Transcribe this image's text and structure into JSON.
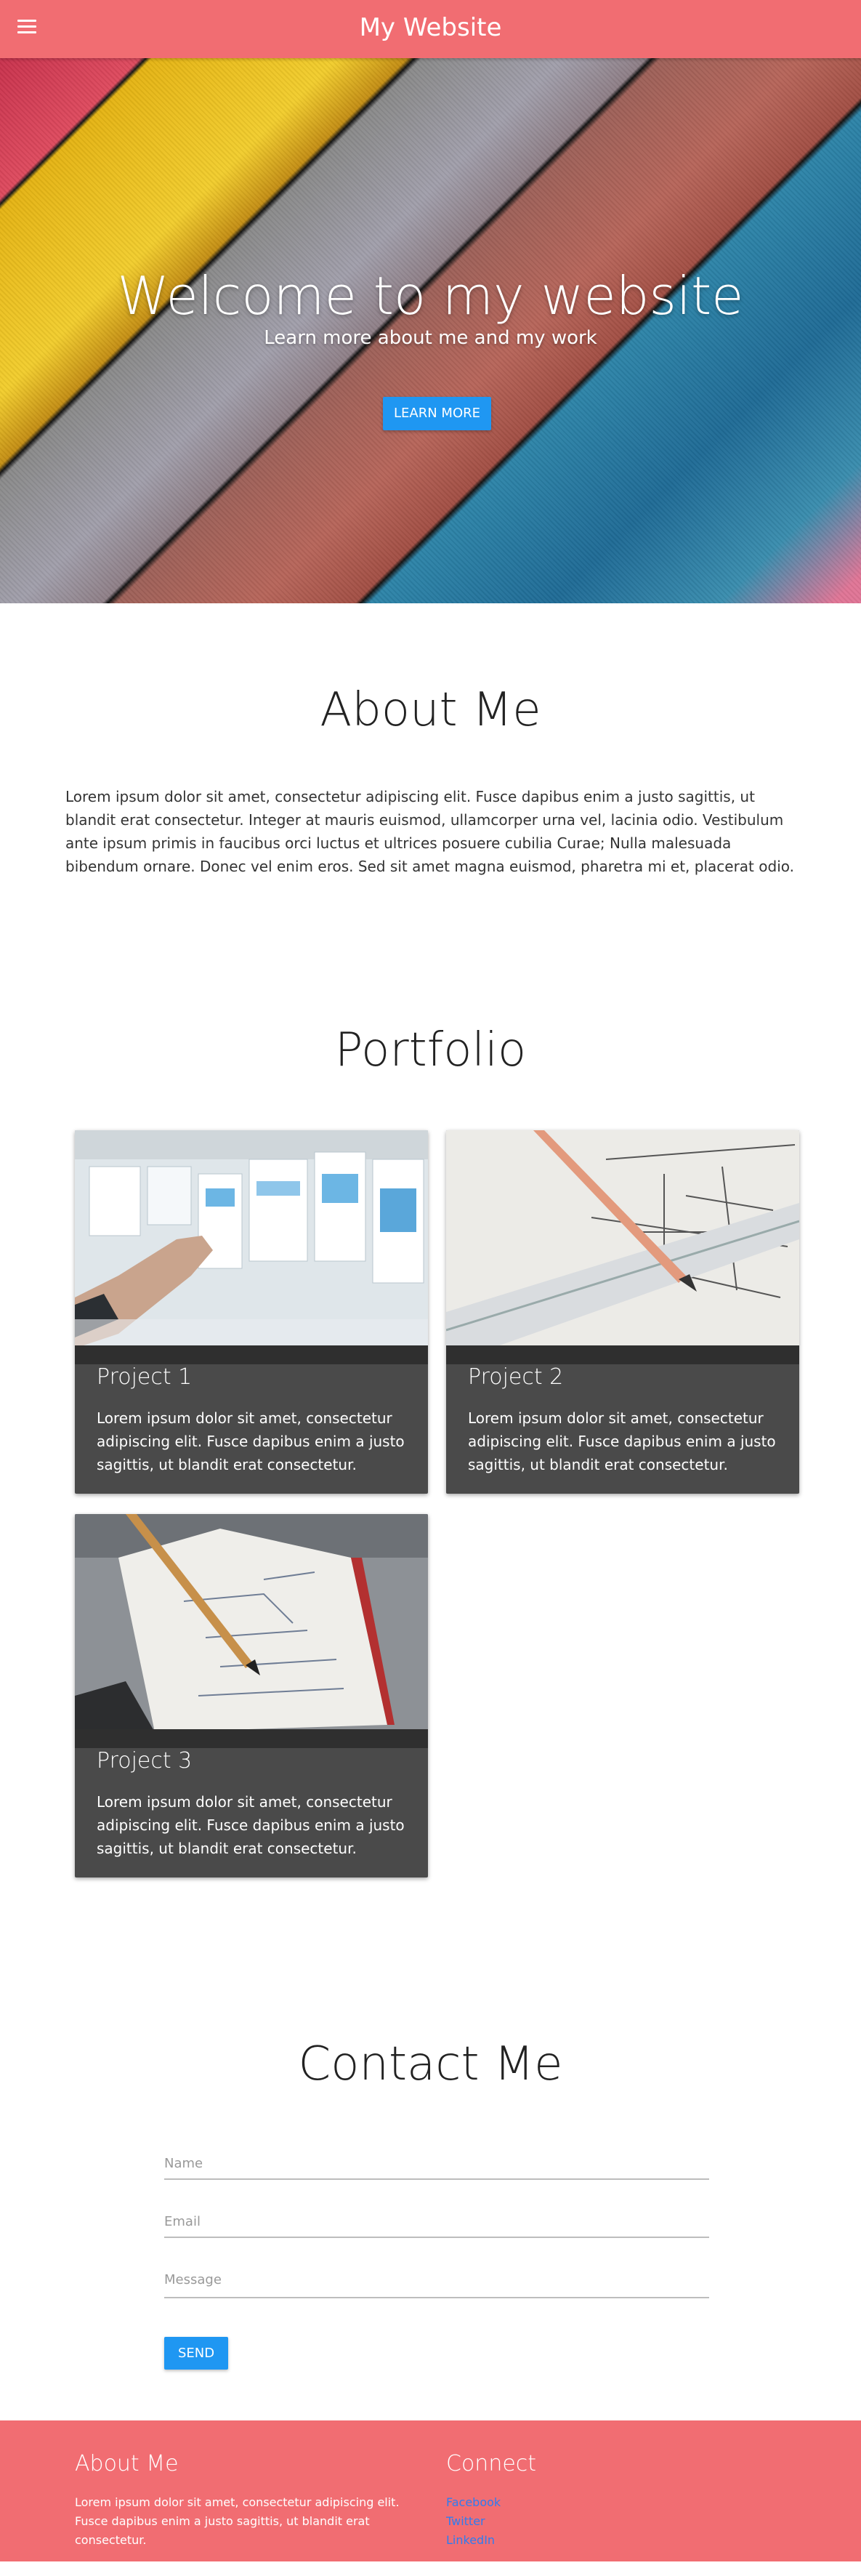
{
  "header": {
    "title": "My Website",
    "menu_icon": "hamburger-menu-icon"
  },
  "hero": {
    "title": "Welcome to my website",
    "subtitle": "Learn more about me and my work",
    "button_label": "LEARN MORE"
  },
  "about": {
    "title": "About Me",
    "text": "Lorem ipsum dolor sit amet, consectetur adipiscing elit. Fusce dapibus enim a justo sagittis, ut blandit erat consectetur. Integer at mauris euismod, ullamcorper urna vel, lacinia odio. Vestibulum ante ipsum primis in faucibus orci luctus et ultrices posuere cubilia Curae; Nulla malesuada bibendum ornare. Donec vel enim eros. Sed sit amet magna euismod, pharetra mi et, placerat odio."
  },
  "portfolio": {
    "title": "Portfolio",
    "projects": [
      {
        "title": "Project 1",
        "text": "Lorem ipsum dolor sit amet, consectetur adipiscing elit. Fusce dapibus enim a justo sagittis, ut blandit erat consectetur."
      },
      {
        "title": "Project 2",
        "text": "Lorem ipsum dolor sit amet, consectetur adipiscing elit. Fusce dapibus enim a justo sagittis, ut blandit erat consectetur."
      },
      {
        "title": "Project 3",
        "text": "Lorem ipsum dolor sit amet, consectetur adipiscing elit. Fusce dapibus enim a justo sagittis, ut blandit erat consectetur."
      }
    ]
  },
  "contact": {
    "title": "Contact Me",
    "name_placeholder": "Name",
    "email_placeholder": "Email",
    "message_placeholder": "Message",
    "send_label": "SEND"
  },
  "footer": {
    "about_title": "About Me",
    "about_text": "Lorem ipsum dolor sit amet, consectetur adipiscing elit. Fusce dapibus enim a justo sagittis, ut blandit erat consectetur.",
    "connect_title": "Connect",
    "links": [
      "Facebook",
      "Twitter",
      "LinkedIn"
    ]
  },
  "colors": {
    "brand": "#f16d72",
    "accent": "#1f97f2",
    "card_bg": "#4a4a4a",
    "link": "#2f7cf0"
  }
}
